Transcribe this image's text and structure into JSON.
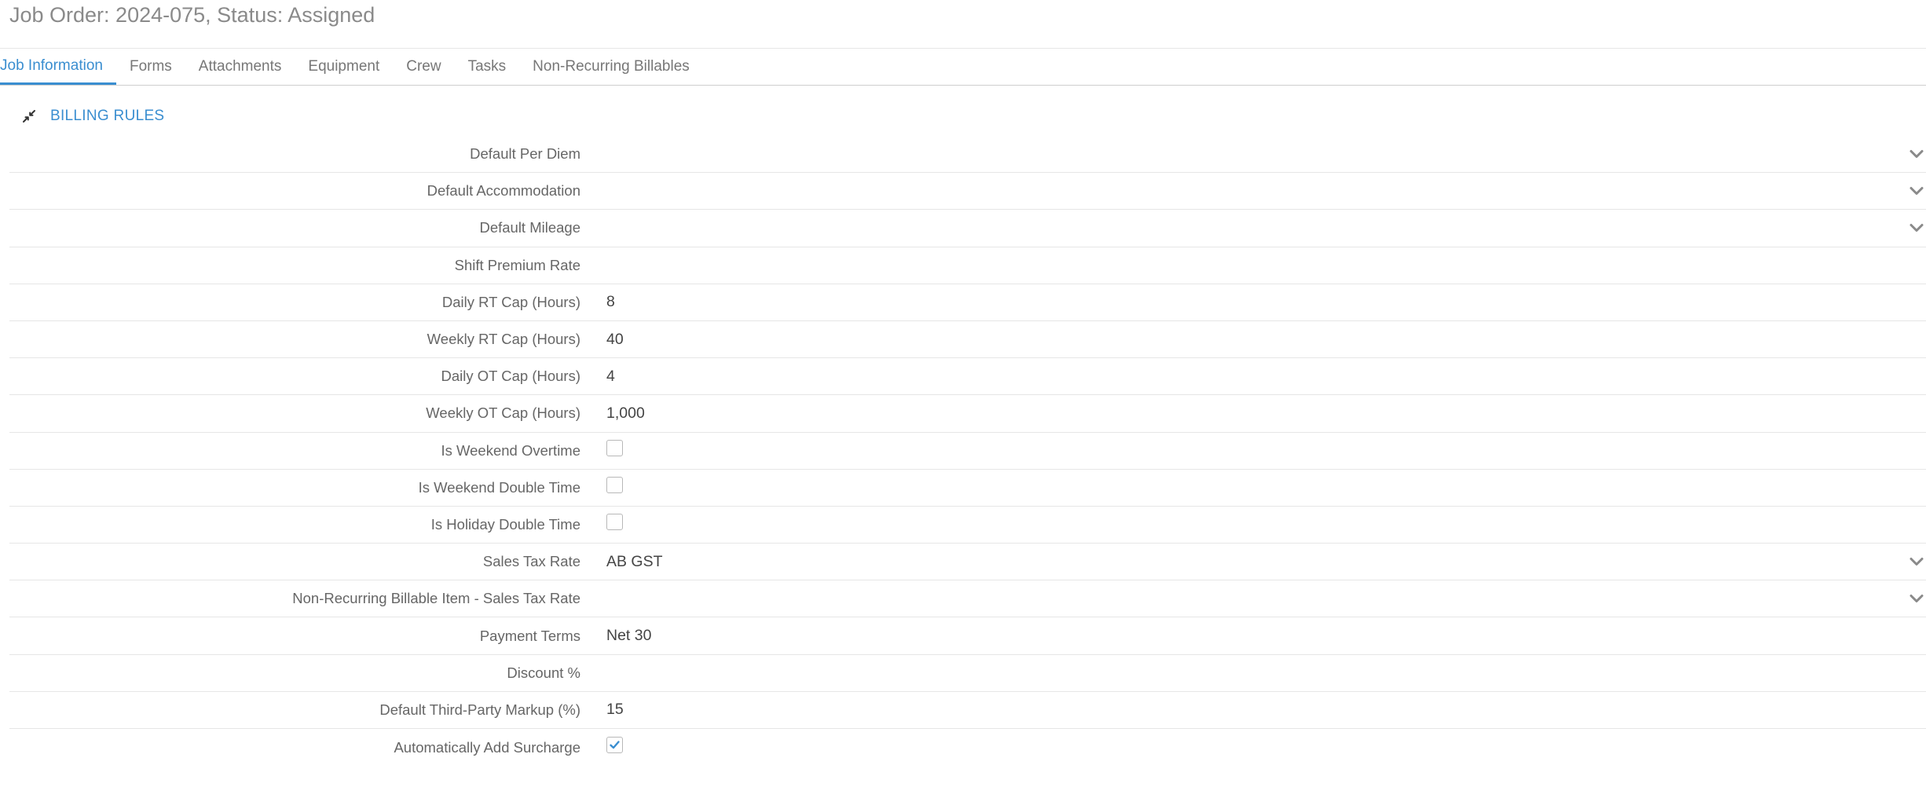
{
  "header": {
    "title": "Job Order: 2024-075, Status: Assigned"
  },
  "tabs": [
    {
      "label": "Job Information",
      "active": true
    },
    {
      "label": "Forms",
      "active": false
    },
    {
      "label": "Attachments",
      "active": false
    },
    {
      "label": "Equipment",
      "active": false
    },
    {
      "label": "Crew",
      "active": false
    },
    {
      "label": "Tasks",
      "active": false
    },
    {
      "label": "Non-Recurring Billables",
      "active": false
    }
  ],
  "section": {
    "title": "BILLING RULES",
    "icon": "collapse-arrows-icon"
  },
  "fields": [
    {
      "label": "Default Per Diem",
      "type": "select",
      "value": ""
    },
    {
      "label": "Default Accommodation",
      "type": "select",
      "value": ""
    },
    {
      "label": "Default Mileage",
      "type": "select",
      "value": ""
    },
    {
      "label": "Shift Premium Rate",
      "type": "text",
      "value": ""
    },
    {
      "label": "Daily RT Cap (Hours)",
      "type": "text",
      "value": "8"
    },
    {
      "label": "Weekly RT Cap (Hours)",
      "type": "text",
      "value": "40"
    },
    {
      "label": "Daily OT Cap (Hours)",
      "type": "text",
      "value": "4"
    },
    {
      "label": "Weekly OT Cap (Hours)",
      "type": "text",
      "value": "1,000"
    },
    {
      "label": "Is Weekend Overtime",
      "type": "checkbox",
      "checked": false
    },
    {
      "label": "Is Weekend Double Time",
      "type": "checkbox",
      "checked": false
    },
    {
      "label": "Is Holiday Double Time",
      "type": "checkbox",
      "checked": false
    },
    {
      "label": "Sales Tax Rate",
      "type": "select",
      "value": "AB GST"
    },
    {
      "label": "Non-Recurring Billable Item - Sales Tax Rate",
      "type": "select",
      "value": ""
    },
    {
      "label": "Payment Terms",
      "type": "text",
      "value": "Net 30"
    },
    {
      "label": "Discount %",
      "type": "text",
      "value": ""
    },
    {
      "label": "Default Third-Party Markup (%)",
      "type": "text",
      "value": "15"
    },
    {
      "label": "Automatically Add Surcharge",
      "type": "checkbox",
      "checked": true
    }
  ],
  "colors": {
    "accent": "#3a8ed0",
    "text": "#666666",
    "divider": "#e6e6e6"
  }
}
